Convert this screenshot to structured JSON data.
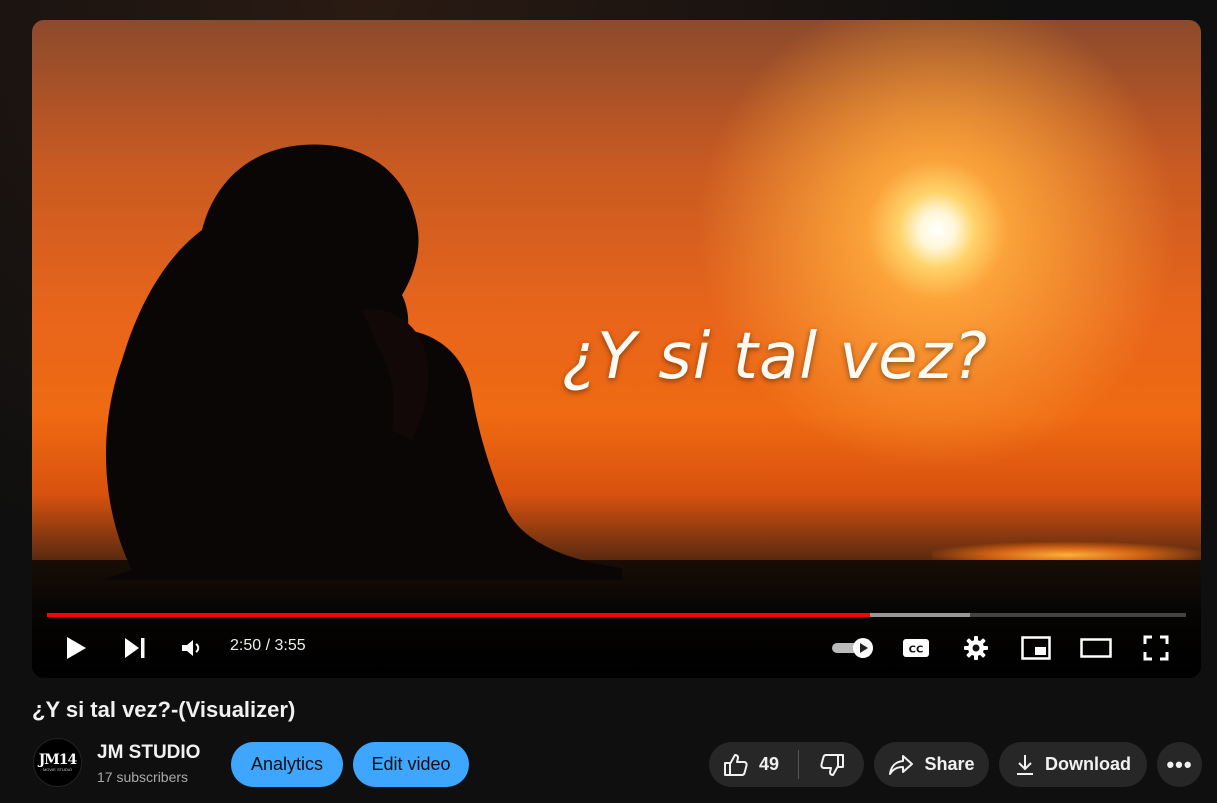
{
  "video": {
    "overlay_text": "¿Y si tal vez?",
    "current_time": "2:50",
    "duration": "3:55",
    "time_display": "2:50 / 3:55",
    "progress_fraction": 0.723,
    "buffered_fraction": 0.81
  },
  "title": "¿Y si tal vez?-(Visualizer)",
  "channel": {
    "name": "JM STUDIO",
    "subscribers": "17 subscribers",
    "avatar_text": "JM14",
    "avatar_subtext": "MOVIE STUDIO"
  },
  "actions": {
    "analytics_label": "Analytics",
    "edit_label": "Edit video",
    "like_count": "49",
    "share_label": "Share",
    "download_label": "Download",
    "more_label": "•••"
  },
  "colors": {
    "accent_blue": "#3ea6ff",
    "progress_red": "#ff0000",
    "chip_bg": "#272727"
  },
  "icons": [
    "play-icon",
    "next-icon",
    "volume-icon",
    "autoplay-toggle-icon",
    "captions-icon",
    "settings-icon",
    "miniplayer-icon",
    "theater-icon",
    "fullscreen-icon",
    "like-icon",
    "dislike-icon",
    "share-icon",
    "download-icon",
    "more-icon"
  ]
}
